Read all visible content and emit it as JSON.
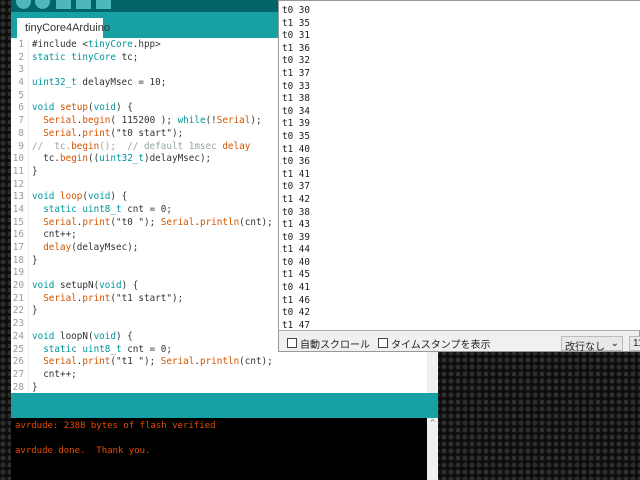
{
  "editor": {
    "tab": "tinyCore4Arduino",
    "lines": [
      "#include <tinyCore.hpp>",
      "static tinyCore tc;",
      "",
      "uint32_t delayMsec = 10;",
      "",
      "void setup(void) {",
      "  Serial.begin( 115200 ); while(!Serial);",
      "  Serial.print(\"t0 start\");",
      "//  tc.begin();  // default 1msec delay",
      "  tc.begin((uint32_t)delayMsec);",
      "}",
      "",
      "void loop(void) {",
      "  static uint8_t cnt = 0;",
      "  Serial.print(\"t0 \"); Serial.println(cnt);",
      "  cnt++;",
      "  delay(delayMsec);",
      "}",
      "",
      "void setupN(void) {",
      "  Serial.print(\"t1 start\");",
      "}",
      "",
      "void loopN(void) {",
      "  static uint8_t cnt = 0;",
      "  Serial.print(\"t1 \"); Serial.println(cnt);",
      "  cnt++;",
      "}"
    ]
  },
  "console": {
    "lines": [
      "avrdude: 2388 bytes of flash verified",
      "",
      "avrdude done.  Thank you."
    ]
  },
  "serial_monitor": {
    "output": [
      "t0 30",
      "t1 35",
      "t0 31",
      "t1 36",
      "t0 32",
      "t1 37",
      "t0 33",
      "t1 38",
      "t0 34",
      "t1 39",
      "t0 35",
      "t1 40",
      "t0 36",
      "t1 41",
      "t0 37",
      "t1 42",
      "t0 38",
      "t1 43",
      "t0 39",
      "t1 44",
      "t0 40",
      "t1 45",
      "t0 41",
      "t1 46",
      "t0 42",
      "t1 47"
    ],
    "autoscroll_label": "自動スクロール",
    "timestamp_label": "タイムスタンプを表示",
    "line_ending": "改行なし",
    "baud": "11"
  }
}
